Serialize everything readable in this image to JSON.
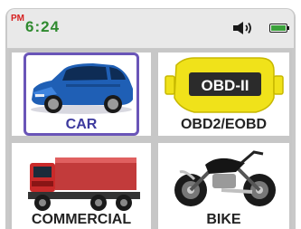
{
  "status_bar": {
    "am_pm": "PM",
    "time": "6:24",
    "volume_icon": "speaker-icon",
    "battery_icon": "battery-icon",
    "colors": {
      "am_pm": "#d62020",
      "time": "#2f8a2f",
      "battery": "#3aa13a"
    }
  },
  "menu": {
    "selected": "CAR",
    "selected_border_color": "#6a55b8",
    "items": [
      {
        "label": "CAR",
        "icon": "car-icon"
      },
      {
        "label": "OBD2/EOBD",
        "icon": "obd-connector-icon",
        "badge": "OBD-II",
        "badge_color": "#f0e21a"
      },
      {
        "label": "COMMERCIAL",
        "icon": "truck-icon"
      },
      {
        "label": "BIKE",
        "icon": "motorcycle-icon"
      }
    ]
  }
}
